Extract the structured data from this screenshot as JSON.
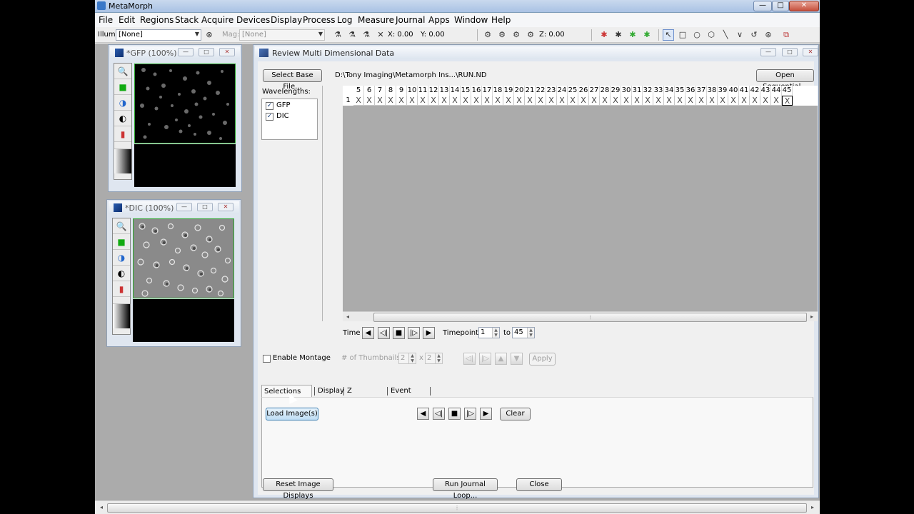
{
  "app": {
    "title": "MetaMorph",
    "window_controls": {
      "minimize": "—",
      "maximize": "□",
      "close": "✕"
    }
  },
  "menu": [
    "File",
    "Edit",
    "Regions",
    "Stack",
    "Acquire",
    "Devices",
    "Display",
    "Process",
    "Log",
    "Measure",
    "Journal",
    "Apps",
    "Window",
    "Help"
  ],
  "toolbar": {
    "illum_label": "Illum:",
    "illum_value": "[None]",
    "mag_label": "Mag:",
    "mag_value": "[None]",
    "x_readout": "X: 0.00",
    "y_readout": "Y: 0.00",
    "z_readout": "Z: 0.00"
  },
  "image_windows": [
    {
      "title": "*GFP (100%)"
    },
    {
      "title": "*DIC (100%)"
    }
  ],
  "dialog": {
    "title": "Review Multi Dimensional Data",
    "select_base_file": "Select Base File...",
    "file_path": "D:\\Tony Imaging\\Metamorph Ins...\\RUN.ND",
    "open_sequential": "Open Sequential...",
    "wavelengths_label": "Wavelengths:",
    "wavelengths": [
      {
        "name": "GFP",
        "checked": true
      },
      {
        "name": "DIC",
        "checked": true
      }
    ],
    "grid": {
      "columns": [
        "5",
        "6",
        "7",
        "8",
        "9",
        "10",
        "11",
        "12",
        "13",
        "14",
        "15",
        "16",
        "17",
        "18",
        "19",
        "20",
        "21",
        "22",
        "23",
        "24",
        "25",
        "26",
        "27",
        "28",
        "29",
        "30",
        "31",
        "32",
        "33",
        "34",
        "35",
        "36",
        "37",
        "38",
        "39",
        "40",
        "41",
        "42",
        "43",
        "44",
        "45"
      ],
      "row_label": "1",
      "cell_mark": "X"
    },
    "time_label": "Time",
    "timepoints_label": "Timepoints:",
    "timepoints_from": "1",
    "to_label": "to",
    "timepoints_to": "45",
    "enable_montage": "Enable Montage",
    "thumbnails_label": "# of Thumbnails:",
    "thumb_cols": "2",
    "thumb_x": "x",
    "thumb_rows": "2",
    "apply": "Apply",
    "tabs": [
      "Selections [X's]",
      "Display",
      "Z Projection",
      "Event marks"
    ],
    "load_images": "Load Image(s)",
    "clear": "Clear",
    "reset_displays": "Reset Image Displays",
    "run_journal_loop": "Run Journal Loop...",
    "close": "Close"
  }
}
